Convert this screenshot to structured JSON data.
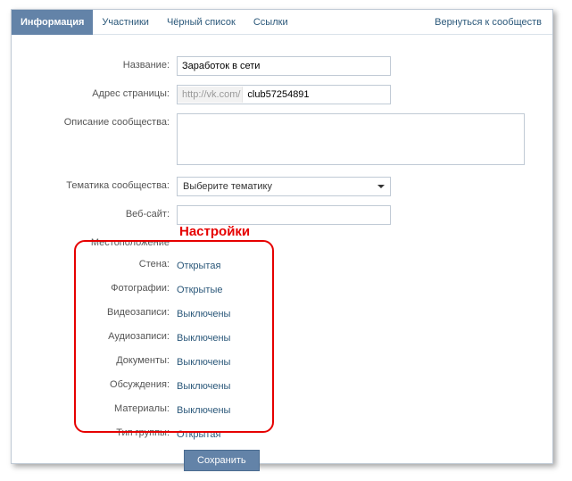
{
  "tabs": {
    "info": "Информация",
    "members": "Участники",
    "blacklist": "Чёрный список",
    "links": "Ссылки",
    "back": "Вернуться к сообществ"
  },
  "form": {
    "name_label": "Название:",
    "name_value": "Заработок в сети",
    "address_label": "Адрес страницы:",
    "address_prefix": "http://vk.com/",
    "address_value": "club57254891",
    "desc_label": "Описание сообщества:",
    "desc_value": "",
    "topic_label": "Тематика сообщества:",
    "topic_value": "Выберите тематику",
    "website_label": "Веб-сайт:",
    "website_value": "",
    "location_label": "Местоположение"
  },
  "annot": "Настройки",
  "settings": {
    "wall_label": "Стена:",
    "wall_value": "Открытая",
    "photos_label": "Фотографии:",
    "photos_value": "Открытые",
    "videos_label": "Видеозаписи:",
    "videos_value": "Выключены",
    "audios_label": "Аудиозаписи:",
    "audios_value": "Выключены",
    "docs_label": "Документы:",
    "docs_value": "Выключены",
    "discussions_label": "Обсуждения:",
    "discussions_value": "Выключены",
    "materials_label": "Материалы:",
    "materials_value": "Выключены",
    "group_type_label": "Тип группы:",
    "group_type_value": "Открытая"
  },
  "save": "Сохранить"
}
